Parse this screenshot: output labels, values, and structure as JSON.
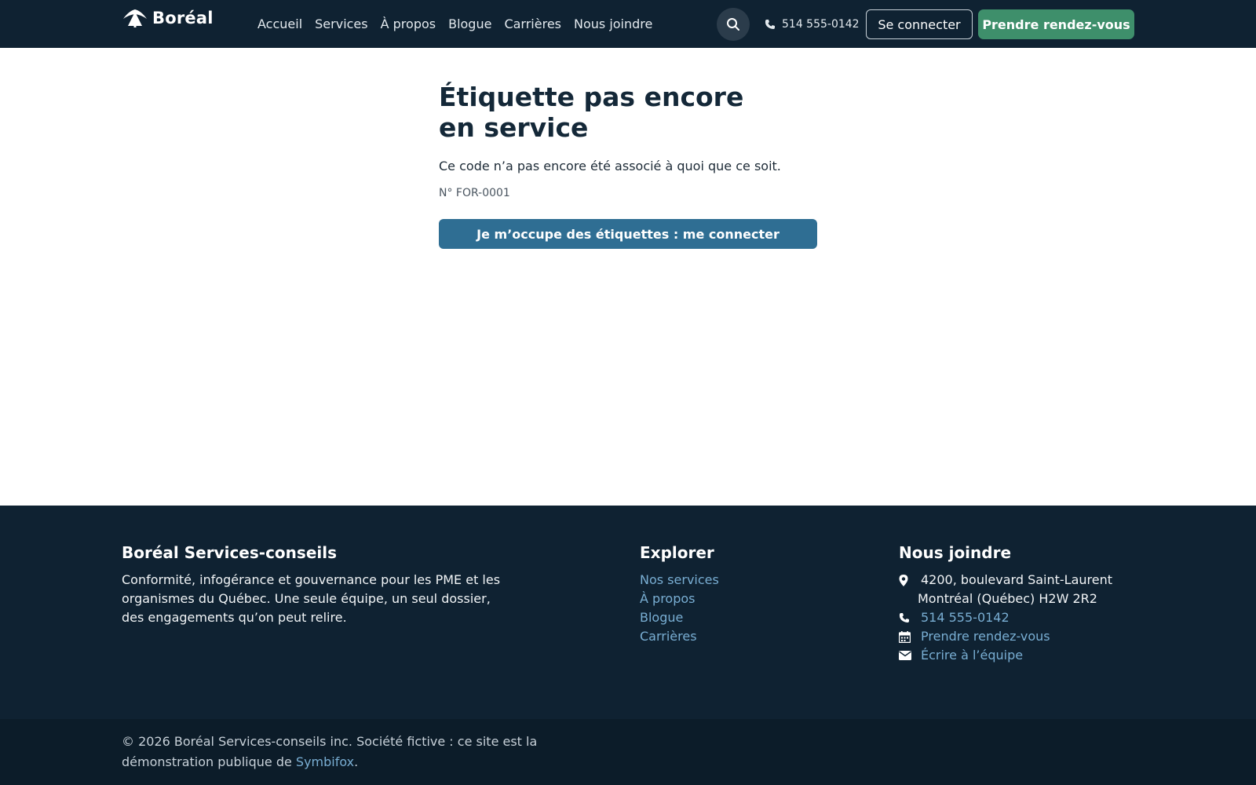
{
  "header": {
    "brand": "Boréal",
    "logo_icon": "tree-logo-icon",
    "nav": [
      "Accueil",
      "Services",
      "À propos",
      "Blogue",
      "Carrières",
      "Nous joindre"
    ],
    "search_icon": "search-icon",
    "phone": "514 555-0142",
    "login_label": "Se connecter",
    "appointment_label": "Prendre rendez-vous"
  },
  "main": {
    "title": "Étiquette pas encore en service",
    "message": "Ce code n’a pas encore été associé à quoi que ce soit.",
    "tag_number": "N° FOR-0001",
    "action_label": "Je m’occupe des étiquettes : me connecter"
  },
  "footer": {
    "company_heading": "Boréal Services-conseils",
    "company_desc": "Conformité, infogérance et gouvernance pour les PME et les organismes du Québec. Une seule équipe, un seul dossier, des engagements qu’on peut relire.",
    "explore_heading": "Explorer",
    "explore_links": [
      "Nos services",
      "À propos",
      "Blogue",
      "Carrières"
    ],
    "contact_heading": "Nous joindre",
    "address_line1": "4200, boulevard Saint-Laurent",
    "address_line2": "Montréal (Québec) H2W 2R2",
    "phone": "514 555-0142",
    "appointment": "Prendre rendez-vous",
    "email": "Écrire à l’équipe",
    "copyright_text": "© 2026 Boréal Services-conseils inc. Société fictive : ce site est la démonstration publique de ",
    "copyright_link": "Symbifox",
    "copyright_end": "."
  },
  "colors": {
    "navy": "#0f2232",
    "green_button": "#3e8f6b",
    "blue_button": "#2f6e93",
    "link_blue": "#79aed3"
  }
}
